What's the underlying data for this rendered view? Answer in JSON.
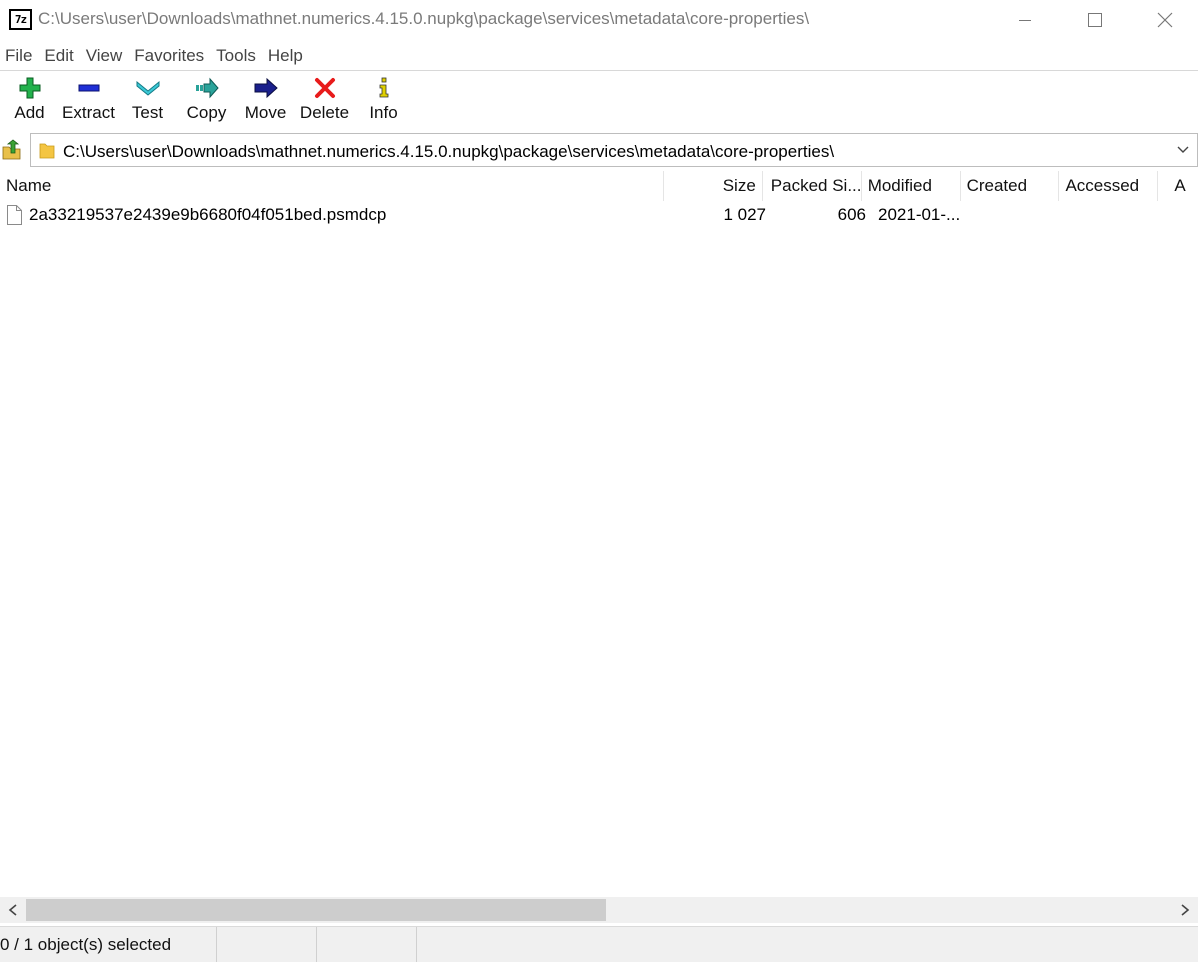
{
  "window": {
    "title": "C:\\Users\\user\\Downloads\\mathnet.numerics.4.15.0.nupkg\\package\\services\\metadata\\core-properties\\",
    "app_icon_text": "7z",
    "controls": [
      "minimize-icon",
      "maximize-icon",
      "close-icon"
    ]
  },
  "menu": {
    "items": [
      "File",
      "Edit",
      "View",
      "Favorites",
      "Tools",
      "Help"
    ]
  },
  "toolbar": {
    "buttons": [
      {
        "label": "Add",
        "icon": "add-icon",
        "color": "#22b14c"
      },
      {
        "label": "Extract",
        "icon": "extract-icon",
        "color": "#1f2fd6"
      },
      {
        "label": "Test",
        "icon": "test-icon",
        "color": "#3cc9d6"
      },
      {
        "label": "Copy",
        "icon": "copy-icon",
        "color": "#2aa39a"
      },
      {
        "label": "Move",
        "icon": "move-icon",
        "color": "#1a1f8c"
      },
      {
        "label": "Delete",
        "icon": "delete-icon",
        "color": "#e81b1b"
      },
      {
        "label": "Info",
        "icon": "info-icon",
        "color": "#e0d000"
      }
    ]
  },
  "address": {
    "path": "C:\\Users\\user\\Downloads\\mathnet.numerics.4.15.0.nupkg\\package\\services\\metadata\\core-properties\\"
  },
  "list": {
    "columns": [
      "Name",
      "Size",
      "Packed Si...",
      "Modified",
      "Created",
      "Accessed",
      "A"
    ],
    "rows": [
      {
        "name": "2a33219537e2439e9b6680f04f051bed.psmdcp",
        "size": "1 027",
        "packed": "606",
        "modified": "2021-01-..."
      }
    ]
  },
  "status": {
    "selection": "0 / 1 object(s) selected",
    "cell2": "",
    "cell3": ""
  }
}
